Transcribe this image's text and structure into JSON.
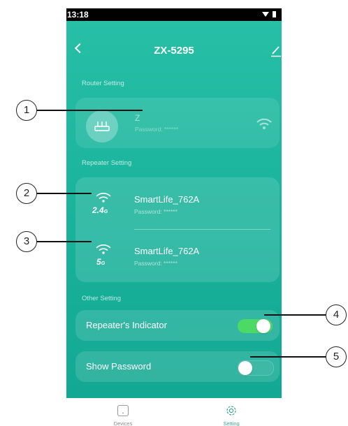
{
  "status_bar": {
    "time": "13:18"
  },
  "header": {
    "title": "ZX-5295"
  },
  "router_section": {
    "label": "Router Setting",
    "name": "Z",
    "password": "Password:  ******"
  },
  "repeater_section": {
    "label": "Repeater Setting",
    "items": [
      {
        "band": "2.4",
        "band_unit": "G",
        "ssid": "SmartLife_762A",
        "password": "Password:  ******"
      },
      {
        "band": "5",
        "band_unit": "G",
        "ssid": "SmartLife_762A",
        "password": "Password:  ******"
      }
    ]
  },
  "other_section": {
    "label": "Other Setting",
    "toggles": [
      {
        "label": "Repeater's Indicator",
        "on": true
      },
      {
        "label": "Show Password",
        "on": false
      }
    ]
  },
  "tab_bar": {
    "tabs": [
      {
        "label": "Devices",
        "icon": "device-icon",
        "active": false
      },
      {
        "label": "Setting",
        "icon": "gear-icon",
        "active": true
      }
    ]
  },
  "callouts": [
    "1",
    "2",
    "3",
    "4",
    "5"
  ],
  "colors": {
    "accent": "#1bb49d",
    "toggle_on": "#4cd964",
    "active_tab": "#3aa693"
  }
}
